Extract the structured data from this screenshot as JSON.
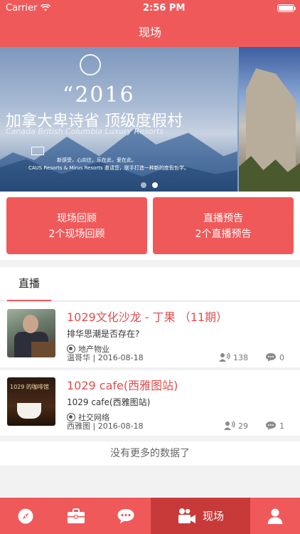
{
  "status": {
    "carrier": "Carrier",
    "time": "2:56 PM"
  },
  "nav": {
    "title": "现场"
  },
  "banner": {
    "year": "2016",
    "title_cn": "加拿大卑诗省 顶级度假村",
    "title_en": "Canada British Columbia Luxury Resorts",
    "note_line1": "新感受，心向往，乐在此，爱在此。",
    "note_line2": "CAUS Resorts & Mirus Resorts 邀请您，联手打造一种新的度假哲学。",
    "page_count": 2,
    "active_page": 2
  },
  "actions": [
    {
      "title": "现场回顾",
      "subtitle": "2个现场回顾"
    },
    {
      "title": "直播预告",
      "subtitle": "2个直播预告"
    }
  ],
  "section": {
    "tab_label": "直播"
  },
  "items": [
    {
      "title": "1029文化沙龙 - 丁果 （11期）",
      "subtitle": "排华思潮是否存在?",
      "tag": "地产物业",
      "author_date": "温哥华 | 2016-08-18",
      "listeners": "138",
      "comments": "0"
    },
    {
      "title": "1029 cafe(西雅图站)",
      "subtitle": "1029 cafe(西雅图站)",
      "tag": "社交网络",
      "author_date": "西雅图 | 2016-08-18",
      "listeners": "29",
      "comments": "1",
      "thumb_label": "1029 的咖啡馆"
    }
  ],
  "footer_note": "没有更多的数据了",
  "tabbar": {
    "items": [
      {
        "icon": "compass-icon"
      },
      {
        "icon": "briefcase-icon"
      },
      {
        "icon": "chat-bubble-icon"
      },
      {
        "icon": "video-camera-icon",
        "label": "现场",
        "active": true
      },
      {
        "icon": "person-icon"
      }
    ]
  },
  "colors": {
    "accent": "#f0595a",
    "accent_dark": "#c8393a",
    "title_red": "#e54c4e"
  }
}
